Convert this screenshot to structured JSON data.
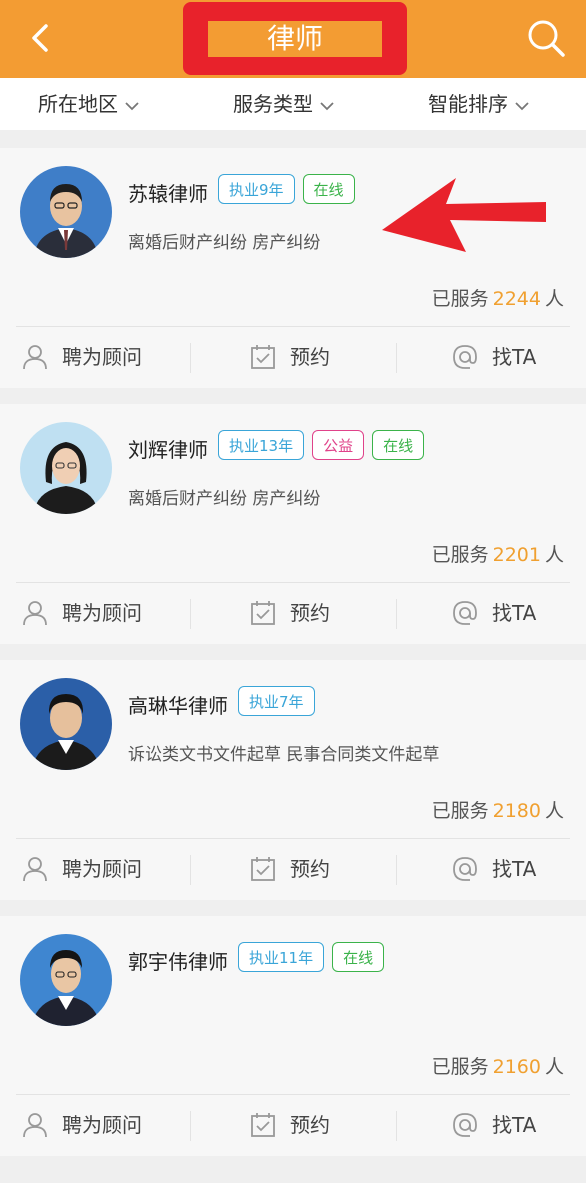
{
  "header": {
    "title": "律师",
    "back_icon": "chevron-left-icon",
    "search_icon": "search-icon"
  },
  "filters": [
    {
      "label": "所在地区"
    },
    {
      "label": "服务类型"
    },
    {
      "label": "智能排序"
    }
  ],
  "colors": {
    "header": "#f39c33",
    "highlight": "#e8222b",
    "served_count": "#f0a030",
    "tag_experience": "#3aa5d8",
    "tag_online": "#3bb34a",
    "tag_public": "#e0428a"
  },
  "lawyers": [
    {
      "name": "苏辕律师",
      "tags": [
        "执业9年",
        "在线"
      ],
      "specialty": "离婚后财产纠纷 房产纠纷",
      "served_prefix": "已服务",
      "served_count": "2244",
      "served_suffix": "人"
    },
    {
      "name": "刘辉律师",
      "tags": [
        "执业13年",
        "公益",
        "在线"
      ],
      "specialty": "离婚后财产纠纷 房产纠纷",
      "served_prefix": "已服务",
      "served_count": "2201",
      "served_suffix": "人"
    },
    {
      "name": "高琳华律师",
      "tags": [
        "执业7年"
      ],
      "specialty": "诉讼类文书文件起草 民事合同类文件起草",
      "served_prefix": "已服务",
      "served_count": "2180",
      "served_suffix": "人"
    },
    {
      "name": "郭宇伟律师",
      "tags": [
        "执业11年",
        "在线"
      ],
      "specialty": "",
      "served_prefix": "已服务",
      "served_count": "2160",
      "served_suffix": "人"
    }
  ],
  "actions": {
    "hire": "聘为顾问",
    "appointment": "预约",
    "contact": "找TA"
  }
}
